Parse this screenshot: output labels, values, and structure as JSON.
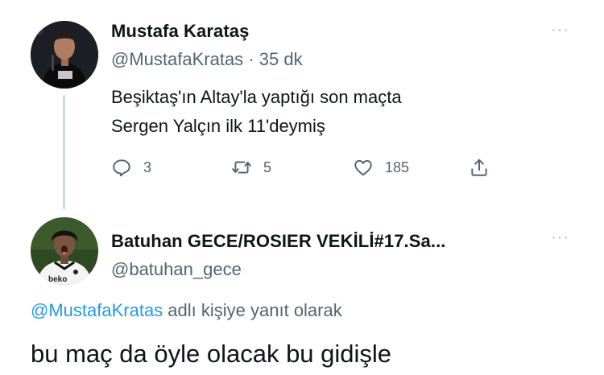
{
  "tweet": {
    "author_name": "Mustafa Karataş",
    "author_handle": "@MustafaKratas",
    "separator": "·",
    "time": "35 dk",
    "more": "···",
    "text_line1": "Beşiktaş'ın Altay'la yaptığı son maçta",
    "text_line2": "Sergen Yalçın ilk 11'deymiş",
    "actions": {
      "reply_count": "3",
      "retweet_count": "5",
      "like_count": "185"
    }
  },
  "reply": {
    "author_name": "Batuhan GECE/ROSIER VEKİLİ#17.Sa...",
    "author_handle": "@batuhan_gece",
    "more": "···",
    "replying_to_mention": "@MustafaKratas",
    "replying_to_suffix": " adlı kişiye yanıt olarak",
    "text": "bu maç da öyle olacak bu gidişle",
    "avatar_shirt_text": "beko"
  },
  "colors": {
    "text": "#0f1419",
    "secondary": "#536471",
    "link": "#1d9bf0",
    "thread_line": "#cfd9de"
  }
}
